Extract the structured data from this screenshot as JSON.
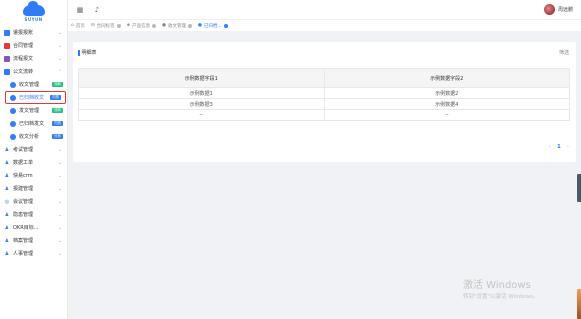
{
  "logo": {
    "brand": "SUYUN"
  },
  "header": {
    "menu_icon": "grid-icon",
    "bell_icon": "bell-icon",
    "username": "周远鹏"
  },
  "sidebar": {
    "items": [
      {
        "label": "遣报报账",
        "icon": "report-icon",
        "color": "#2f7cf6"
      },
      {
        "label": "合同管理",
        "icon": "contract-icon",
        "color": "#e53935"
      },
      {
        "label": "流程报文",
        "icon": "flow-icon",
        "color": "#7e57c2"
      },
      {
        "label": "公文流转",
        "icon": "doc-icon",
        "color": "#2f7cf6",
        "expanded": true
      }
    ],
    "sub_items": [
      {
        "label": "收文管理",
        "badge": "流转",
        "badge_color": "#26c281"
      },
      {
        "label": "已归档收文",
        "badge": "归档",
        "badge_color": "#2f7cf6",
        "active": true
      },
      {
        "label": "发文管理",
        "badge": "流转",
        "badge_color": "#26c281"
      },
      {
        "label": "已归档发文",
        "badge": "归档",
        "badge_color": "#2f7cf6"
      },
      {
        "label": "收文分析",
        "badge": "分析",
        "badge_color": "#2f7cf6"
      }
    ],
    "items_after": [
      {
        "label": "考试管理",
        "icon": "person-icon"
      },
      {
        "label": "数据工单",
        "icon": "person-icon"
      },
      {
        "label": "快易crm",
        "icon": "person-icon"
      },
      {
        "label": "报建管理",
        "icon": "person-icon"
      },
      {
        "label": "会议管理",
        "icon": "meeting-icon"
      },
      {
        "label": "隐患管理",
        "icon": "person-icon"
      },
      {
        "label": "OKR目标...",
        "icon": "person-icon"
      },
      {
        "label": "档案管理",
        "icon": "person-icon"
      },
      {
        "label": "人事管理",
        "icon": "person-icon"
      }
    ]
  },
  "tabs": [
    {
      "label": "首页",
      "icon": "home-icon"
    },
    {
      "label": "合同标签",
      "icon": "tag-icon"
    },
    {
      "label": "产品信息",
      "icon": "product-icon"
    },
    {
      "label": "收文管理",
      "icon": "doc-icon"
    },
    {
      "label": "已归档...",
      "icon": "doc-icon",
      "active": true
    }
  ],
  "card": {
    "title": "明细表",
    "filter_label": "筛选",
    "table": {
      "headers": [
        "示例数据字段1",
        "示例数据字段2"
      ],
      "rows": [
        [
          "示例数据1",
          "示例数据2"
        ],
        [
          "示例数据3",
          "示例数据4"
        ],
        [
          "--",
          "--"
        ]
      ]
    },
    "pager": {
      "prev": "‹",
      "current": "1",
      "next": "›"
    }
  },
  "watermark": {
    "line1": "激活 Windows",
    "line2": "转到\"设置\"以激活 Windows。"
  },
  "colors": {
    "accent": "#2f7cf6",
    "active_border": "#e53935"
  }
}
